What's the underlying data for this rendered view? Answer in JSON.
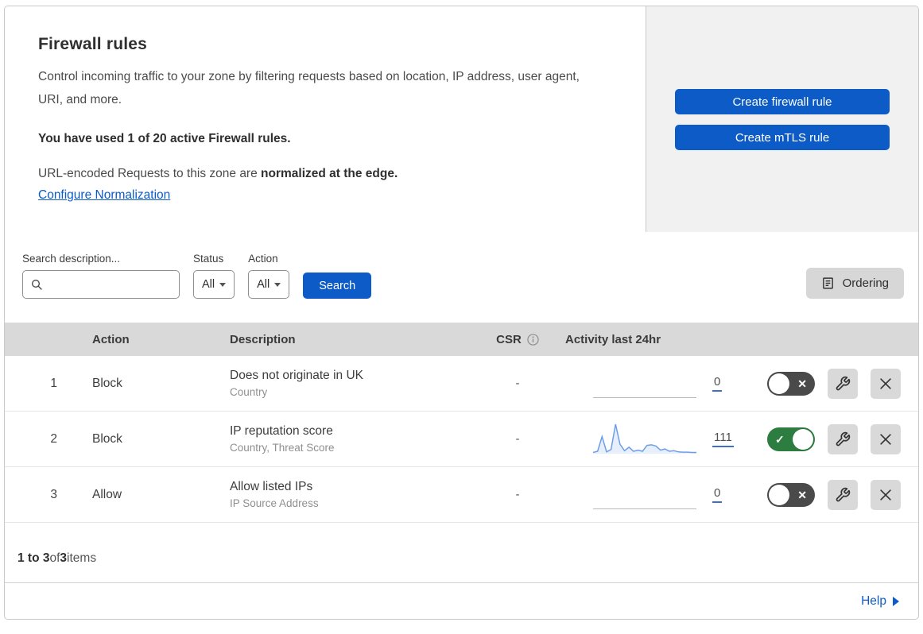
{
  "header": {
    "title": "Firewall rules",
    "description": "Control incoming traffic to your zone by filtering requests based on location, IP address, user agent, URI, and more.",
    "usage_text": "You have used 1 of 20 active Firewall rules.",
    "normalization_text": "URL-encoded Requests to this zone are ",
    "normalization_bold": "normalized at the edge.",
    "normalization_link": "Configure Normalization",
    "create_firewall_button": "Create firewall rule",
    "create_mtls_button": "Create mTLS rule"
  },
  "filters": {
    "search_label": "Search description...",
    "search_value": "",
    "status_label": "Status",
    "status_value": "All",
    "action_label": "Action",
    "action_value": "All",
    "search_button": "Search",
    "ordering_button": "Ordering"
  },
  "table": {
    "headers": {
      "action": "Action",
      "description": "Description",
      "csr": "CSR",
      "activity": "Activity last 24hr"
    },
    "rows": [
      {
        "number": "1",
        "action": "Block",
        "description": "Does not originate in UK",
        "criteria": "Country",
        "csr": "-",
        "activity_count": "0",
        "enabled": false,
        "sparkline": []
      },
      {
        "number": "2",
        "action": "Block",
        "description": "IP reputation score",
        "criteria": "Country, Threat Score",
        "csr": "-",
        "activity_count": "111",
        "enabled": true,
        "sparkline": [
          4,
          8,
          58,
          6,
          14,
          100,
          32,
          10,
          22,
          8,
          12,
          8,
          28,
          30,
          26,
          12,
          16,
          8,
          10,
          6,
          5,
          5,
          4,
          4
        ]
      },
      {
        "number": "3",
        "action": "Allow",
        "description": "Allow listed IPs",
        "criteria": "IP Source Address",
        "csr": "-",
        "activity_count": "0",
        "enabled": false,
        "sparkline": []
      }
    ]
  },
  "footer": {
    "range_bold": "1 to 3",
    "of_text": " of ",
    "total_bold": "3",
    "items_text": " items",
    "help_label": "Help"
  },
  "icons": {
    "toggle_on_check": "✓",
    "toggle_off_x": "✕"
  },
  "colors": {
    "accent_blue": "#0d5bc6",
    "toggle_on_green": "#2c7d3f",
    "toggle_off_gray": "#4a4a4a",
    "sparkline_blue": "#6d9eeb",
    "table_header_gray": "#d9d9d9",
    "panel_gray": "#f1f1f1"
  }
}
